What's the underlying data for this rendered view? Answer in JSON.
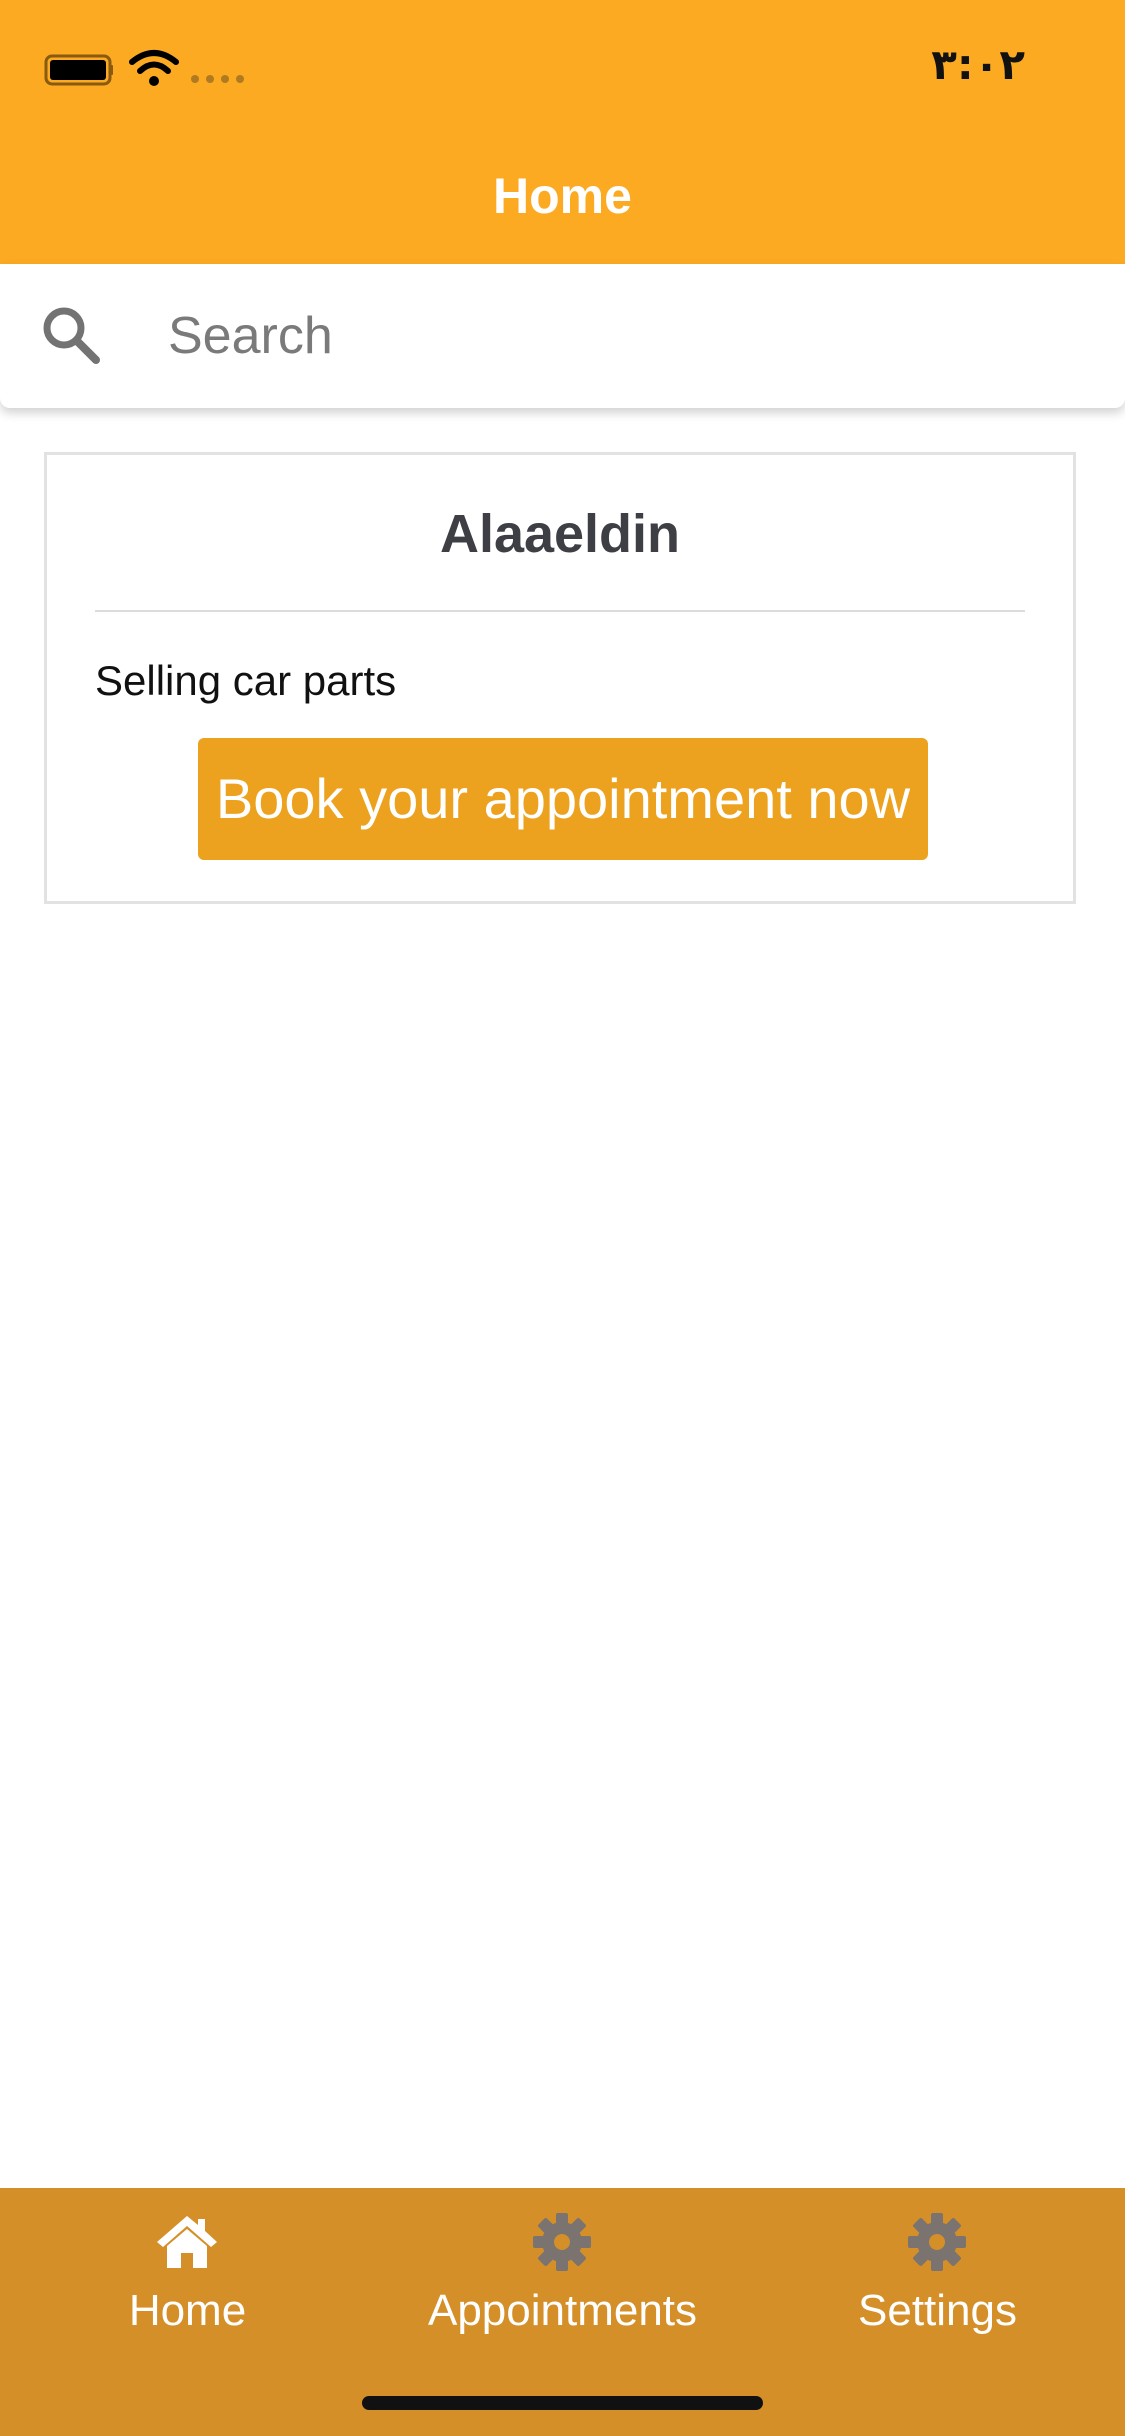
{
  "status_bar": {
    "time": "٣:٠٢"
  },
  "header": {
    "title": "Home"
  },
  "search": {
    "placeholder": "Search",
    "value": ""
  },
  "card": {
    "title": "Alaaeldin",
    "description": "Selling car parts",
    "button_label": "Book your appointment now"
  },
  "tabs": [
    {
      "label": "Home",
      "icon": "home-icon",
      "active": true
    },
    {
      "label": "Appointments",
      "icon": "gear-icon",
      "active": false
    },
    {
      "label": "Settings",
      "icon": "gear-icon",
      "active": false
    }
  ],
  "colors": {
    "header_bg": "#FBAA22",
    "button_bg": "#ECA21E",
    "tab_bar_bg": "#D58F28",
    "active_icon": "#ffffff",
    "inactive_icon": "#7a7370"
  }
}
